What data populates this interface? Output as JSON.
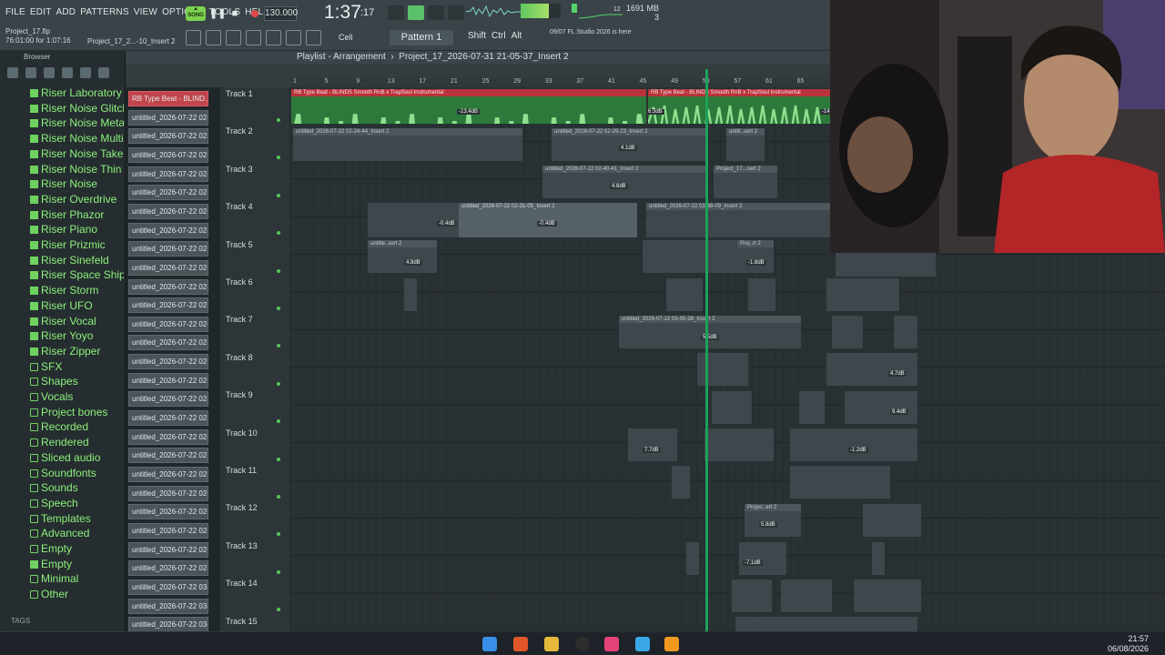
{
  "menu": [
    "FILE",
    "EDIT",
    "ADD",
    "PATTERNS",
    "VIEW",
    "OPTIONS",
    "TOOLS",
    "HELP"
  ],
  "transport": {
    "song_label": "SONG",
    "tempo": "130.000",
    "time": "1:37",
    "time_frac": ":17",
    "mem": "1691 MB",
    "voices": "12",
    "cpu_num": "3"
  },
  "project": {
    "file": "Project_17.flp",
    "position": "76:01:00 for 1:07:16",
    "insert": "Project_17_2...-10_Insert 2"
  },
  "toolbar": {
    "snap": "Cell",
    "pattern": "Pattern 1",
    "mods": [
      "Shift",
      "Ctrl",
      "Alt"
    ],
    "hint_date": "09/07",
    "hint": "FL Studio 2026 is here"
  },
  "playlist": {
    "title": "Playlist - Arrangement",
    "breadcrumb": "Project_17_2026-07-31 21-05-37_Insert 2"
  },
  "ruler": [
    "1",
    "5",
    "9",
    "13",
    "17",
    "21",
    "25",
    "29",
    "33",
    "37",
    "41",
    "45",
    "49",
    "53",
    "57",
    "61",
    "65"
  ],
  "browser": {
    "title": "Browser",
    "items": [
      {
        "label": "Riser Laboratory",
        "type": "file"
      },
      {
        "label": "Riser Noise Glitchy",
        "type": "file"
      },
      {
        "label": "Riser Noise Metal",
        "type": "file"
      },
      {
        "label": "Riser Noise Multi",
        "type": "file"
      },
      {
        "label": "Riser Noise Takeoff",
        "type": "file"
      },
      {
        "label": "Riser Noise Thin",
        "type": "file"
      },
      {
        "label": "Riser Noise",
        "type": "file"
      },
      {
        "label": "Riser Overdrive",
        "type": "file"
      },
      {
        "label": "Riser Phazor",
        "type": "file"
      },
      {
        "label": "Riser Piano",
        "type": "file"
      },
      {
        "label": "Riser Prizmic",
        "type": "file"
      },
      {
        "label": "Riser Sinefeld",
        "type": "file"
      },
      {
        "label": "Riser Space Ship",
        "type": "file"
      },
      {
        "label": "Riser Storm",
        "type": "file"
      },
      {
        "label": "Riser UFO",
        "type": "file"
      },
      {
        "label": "Riser Vocal",
        "type": "file"
      },
      {
        "label": "Riser Yoyo",
        "type": "file"
      },
      {
        "label": "Riser Zipper",
        "type": "file"
      },
      {
        "label": "SFX",
        "type": "folder"
      },
      {
        "label": "Shapes",
        "type": "folder"
      },
      {
        "label": "Vocals",
        "type": "folder"
      },
      {
        "label": "Project bones",
        "type": "folder"
      },
      {
        "label": "Recorded",
        "type": "folder"
      },
      {
        "label": "Rendered",
        "type": "folder"
      },
      {
        "label": "Sliced audio",
        "type": "folder"
      },
      {
        "label": "Soundfonts",
        "type": "folder"
      },
      {
        "label": "Sounds",
        "type": "folder"
      },
      {
        "label": "Speech",
        "type": "folder"
      },
      {
        "label": "Templates",
        "type": "folder"
      },
      {
        "label": "Advanced",
        "type": "folder"
      },
      {
        "label": "Empty",
        "type": "folder"
      },
      {
        "label": "Empty",
        "type": "file"
      },
      {
        "label": "Minimal",
        "type": "folder"
      },
      {
        "label": "Other",
        "type": "folder"
      }
    ],
    "tags_label": "TAGS"
  },
  "channels": [
    "RB Type Beat - BLIND...",
    "untitled_2026-07-22 02-...",
    "untitled_2026-07-22 02-...",
    "untitled_2026-07-22 02-...",
    "untitled_2026-07-22 02-...",
    "untitled_2026-07-22 02-...",
    "untitled_2026-07-22 02-...",
    "untitled_2026-07-22 02-...",
    "untitled_2026-07-22 02-...",
    "untitled_2026-07-22 02-...",
    "untitled_2026-07-22 02-...",
    "untitled_2026-07-22 02-...",
    "untitled_2026-07-22 02-...",
    "untitled_2026-07-22 02-...",
    "untitled_2026-07-22 02-...",
    "untitled_2026-07-22 02-...",
    "untitled_2026-07-22 02-...",
    "untitled_2026-07-22 02-...",
    "untitled_2026-07-22 02-...",
    "untitled_2026-07-22 02-...",
    "untitled_2026-07-22 02-...",
    "untitled_2026-07-22 02-...",
    "untitled_2026-07-22 02-...",
    "untitled_2026-07-22 02-...",
    "untitled_2026-07-22 02-...",
    "untitled_2026-07-22 02-...",
    "untitled_2026-07-22 03-...",
    "untitled_2026-07-22 03-...",
    "untitled_2026-07-22 03-..."
  ],
  "tracks": [
    "Track 1",
    "Track 2",
    "Track 3",
    "Track 4",
    "Track 5",
    "Track 6",
    "Track 7",
    "Track 8",
    "Track 9",
    "Track 10",
    "Track 11",
    "Track 12",
    "Track 13",
    "Track 14",
    "Track 15"
  ],
  "clip_labels": {
    "beat": "RB Type Beat - BLINDS Smooth RnB x TrapSoul Instrumental",
    "t2a": "untitled_2026-07-22 02-24-44_Insert 2",
    "t2b": "untitled_2026-07-22 02-29-23_Insert 2",
    "t2c": "untitl..sert 2",
    "t3a": "untitled_2026-07-22 02-40-41_Insert 2",
    "t3b": "Project_17...sert 2",
    "t4a": "untitled_2026-07-22 02-31-05_Insert 2",
    "t4b": "untitled_2026-07-22 03-48-09_Insert 2",
    "t5a": "untitle..sert 2",
    "t5b": "Proj..rt 2",
    "t7a": "untitled_2026-07-22 03-55-38_Insert 2",
    "t12a": "Projec..ert 2"
  },
  "gains": [
    "-13.4dB",
    "6.3dB",
    "-14",
    "4.1dB",
    "4.6dB",
    "-0.4dB",
    "-0.4dB",
    "4.8dB",
    "-1.8dB",
    "5.5dB",
    "4.7dB",
    "9.4dB",
    "7.7dB",
    "-1.2dB",
    "5.8dB",
    "-7.1dB"
  ],
  "taskbar": {
    "time": "21:57",
    "date": "06/08/2026"
  }
}
